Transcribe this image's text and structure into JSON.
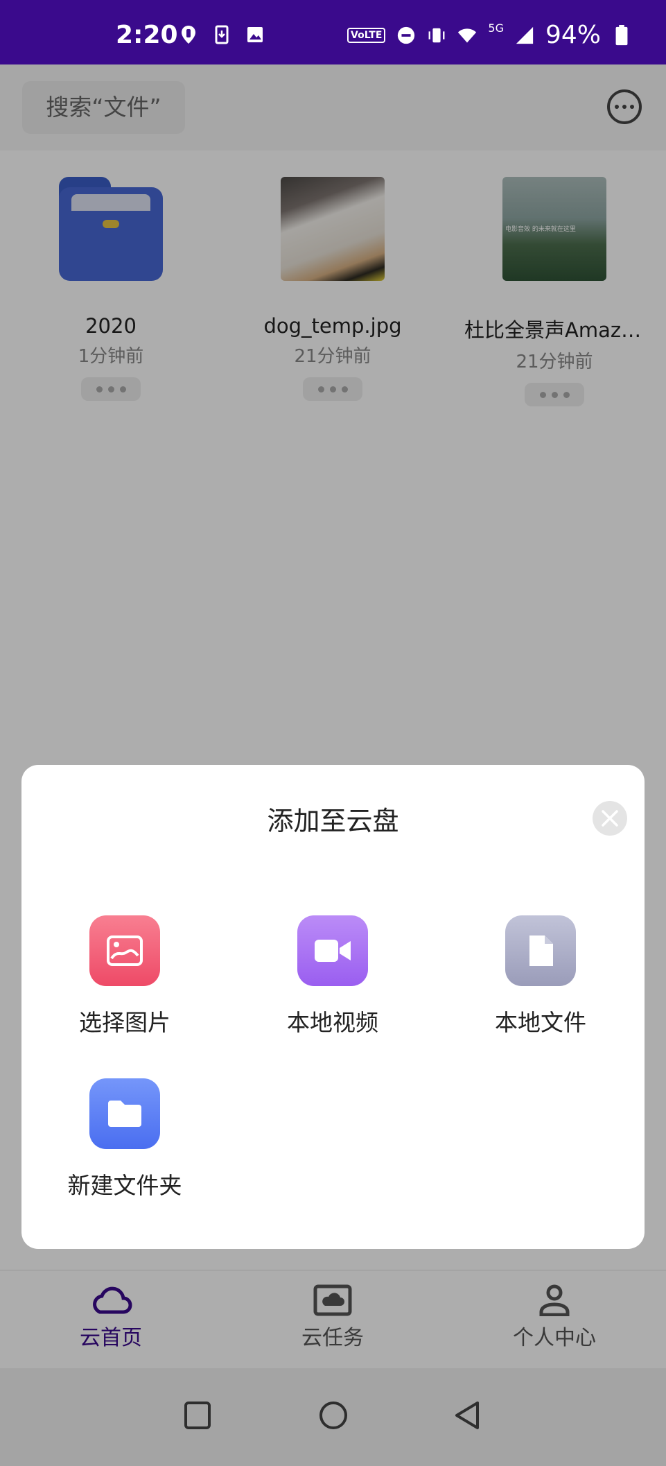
{
  "status_bar": {
    "time": "2:20",
    "battery": "94%",
    "network": "5G",
    "volte": "VoLTE"
  },
  "header": {
    "search_placeholder": "搜索“文件”",
    "more_icon": "more-horizontal-icon"
  },
  "files": [
    {
      "name": "2020",
      "time": "1分钟前",
      "type": "folder"
    },
    {
      "name": "dog_temp.jpg",
      "time": "21分钟前",
      "type": "image"
    },
    {
      "name": "杜比全景声Amaze...",
      "time": "21分钟前",
      "type": "video",
      "thumb_caption": "电影音效 的未来就在这里"
    }
  ],
  "bottom_nav": [
    {
      "label": "云首页",
      "icon": "cloud-icon",
      "active": true
    },
    {
      "label": "云任务",
      "icon": "cloud-task-icon",
      "active": false
    },
    {
      "label": "个人中心",
      "icon": "person-icon",
      "active": false
    }
  ],
  "sheet": {
    "title": "添加至云盘",
    "actions": [
      {
        "label": "选择图片",
        "icon": "image-icon",
        "color": "#f0607a"
      },
      {
        "label": "本地视频",
        "icon": "video-icon",
        "color": "#a970f0"
      },
      {
        "label": "本地文件",
        "icon": "file-icon",
        "color": "#a9abc6"
      },
      {
        "label": "新建文件夹",
        "icon": "folder-icon",
        "color": "#5a7cf4"
      }
    ]
  },
  "colors": {
    "accent": "#3a0a8c",
    "status_bar": "#3a0a8c"
  }
}
